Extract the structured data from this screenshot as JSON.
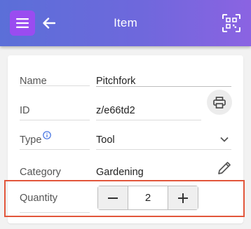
{
  "header": {
    "title": "Item",
    "menu_icon": "menu-icon",
    "back_icon": "back-arrow-icon",
    "scan_icon": "scan-qr-icon",
    "menu_color": "#9a4cf0"
  },
  "fields": {
    "name": {
      "label": "Name",
      "value": "Pitchfork"
    },
    "id": {
      "label": "ID",
      "value": "z/e66td2"
    },
    "type": {
      "label": "Type",
      "value": "Tool"
    },
    "category": {
      "label": "Category",
      "value": "Gardening"
    },
    "quantity": {
      "label": "Quantity",
      "value": "2",
      "minus": "−",
      "plus": "+"
    }
  },
  "colors": {
    "highlight": "#e2563b",
    "info": "#3f6fe0"
  }
}
